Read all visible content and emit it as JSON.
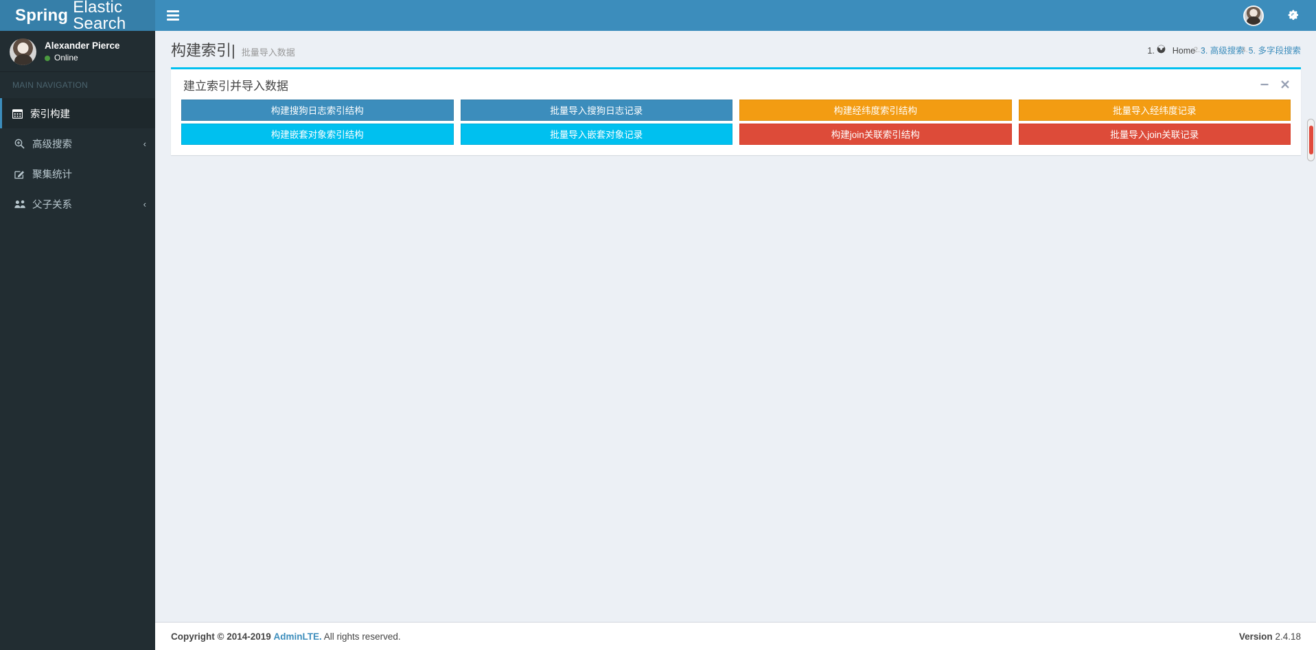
{
  "brand": {
    "bold": "Spring",
    "normal": "Elastic Search"
  },
  "navbar": {
    "toggle_icon": "bars-icon",
    "avatar_icon": "user-avatar",
    "settings_icon": "gears-icon"
  },
  "user_panel": {
    "name": "Alexander Pierce",
    "status": "Online",
    "avatar_icon": "user-avatar"
  },
  "sidebar": {
    "header": "MAIN NAVIGATION",
    "items": [
      {
        "label": "索引构建",
        "icon": "calendar-icon",
        "active": true,
        "chevron": ""
      },
      {
        "label": "高级搜索",
        "icon": "search-plus-icon",
        "active": false,
        "chevron": "‹"
      },
      {
        "label": "聚集统计",
        "icon": "edit-square-icon",
        "active": false,
        "chevron": ""
      },
      {
        "label": "父子关系",
        "icon": "users-icon",
        "active": false,
        "chevron": "‹"
      }
    ]
  },
  "content_header": {
    "title": "构建索引",
    "divider": "|",
    "subtitle": "批量导入数据"
  },
  "breadcrumb": {
    "home_icon": "dashboard-icon",
    "items": [
      "Home",
      "高级搜索",
      "多字段搜索"
    ],
    "separator": "›"
  },
  "box": {
    "title": "建立索引并导入数据",
    "accent_color": "#00c0ef",
    "tools": [
      {
        "name": "minimize-button",
        "glyph": "−"
      },
      {
        "name": "close-button",
        "glyph": "×"
      }
    ],
    "buttons": [
      {
        "label": "构建搜狗日志索引结构",
        "style": "primary",
        "color": "#3c8dbc"
      },
      {
        "label": "批量导入搜狗日志记录",
        "style": "primary",
        "color": "#3c8dbc"
      },
      {
        "label": "构建经纬度索引结构",
        "style": "warning",
        "color": "#f39c12"
      },
      {
        "label": "批量导入经纬度记录",
        "style": "warning",
        "color": "#f39c12"
      },
      {
        "label": "构建嵌套对象索引结构",
        "style": "info",
        "color": "#00c0ef"
      },
      {
        "label": "批量导入嵌套对象记录",
        "style": "info",
        "color": "#00c0ef"
      },
      {
        "label": "构建join关联索引结构",
        "style": "danger",
        "color": "#dd4b39"
      },
      {
        "label": "批量导入join关联记录",
        "style": "danger",
        "color": "#dd4b39"
      }
    ]
  },
  "footer": {
    "copyright_prefix": "Copyright © 2014-2019",
    "copyright_link": "AdminLTE.",
    "copyright_suffix": "All rights reserved.",
    "version_label": "Version",
    "version_number": "2.4.18"
  }
}
